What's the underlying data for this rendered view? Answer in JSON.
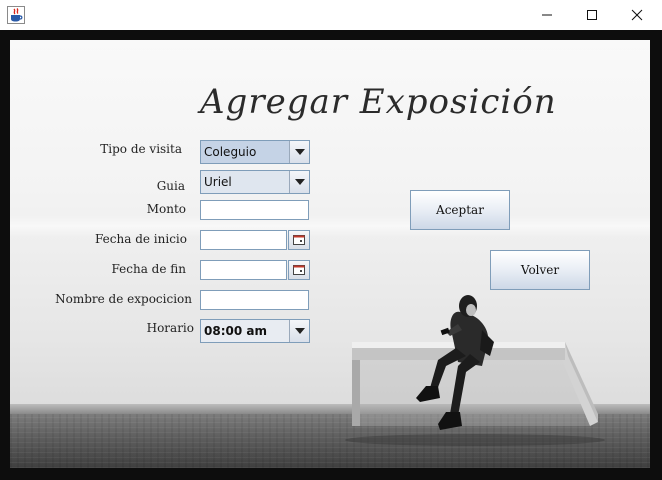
{
  "window": {
    "app_icon": "java-cup-icon",
    "controls": [
      "minimize-icon",
      "maximize-icon",
      "close-icon"
    ]
  },
  "form": {
    "title": "Agregar Exposición",
    "fields": {
      "tipo_visita": {
        "label": "Tipo de visita",
        "value": "Coleguio"
      },
      "guia": {
        "label": "Guia",
        "value": "Uriel"
      },
      "monto": {
        "label": "Monto",
        "value": ""
      },
      "fecha_inicio": {
        "label": "Fecha de inicio",
        "value": ""
      },
      "fecha_fin": {
        "label": "Fecha de fin",
        "value": ""
      },
      "nombre": {
        "label": "Nombre de expocicion",
        "value": ""
      },
      "horario": {
        "label": "Horario",
        "value": "08:00 am"
      }
    },
    "buttons": {
      "accept": "Aceptar",
      "back": "Volver"
    }
  },
  "colors": {
    "frame": "#0d0d0d",
    "field_border": "#7f9db9",
    "combo_selected": "#c5d3e6"
  }
}
